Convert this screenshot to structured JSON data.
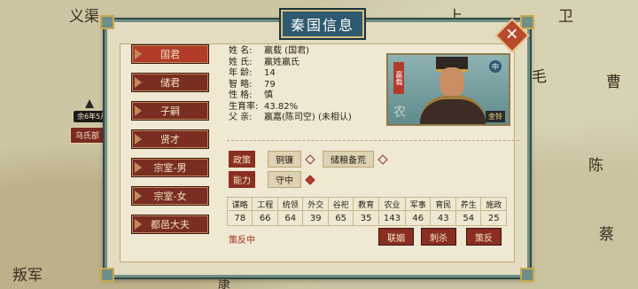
{
  "map": {
    "labels": [
      "义渠",
      "上",
      "卫",
      "毛",
      "曹",
      "陈",
      "蔡",
      "叛军",
      "康"
    ],
    "marker_text": "余6年5月",
    "city_name": "乌氏部"
  },
  "dialog": {
    "title": "秦国信息",
    "close_label": "✕"
  },
  "nav": [
    {
      "label": "国君",
      "active": true
    },
    {
      "label": "储君"
    },
    {
      "label": "子嗣"
    },
    {
      "label": "贤才"
    },
    {
      "label": "宗室-男"
    },
    {
      "label": "宗室-女"
    },
    {
      "label": "都邑大夫"
    }
  ],
  "ruler": {
    "name_label": "姓  名:",
    "name": "嬴载 (国君)",
    "clan_label": "姓  氏:",
    "clan": "嬴姓嬴氏",
    "age_label": "年  龄:",
    "age": "14",
    "int_label": "智  略:",
    "int": "79",
    "trait_label": "性  格:",
    "trait": "慎",
    "fert_label": "生育率:",
    "fert": "43.82%",
    "father_label": "父  亲:",
    "father": "嬴嘉(陈司空) (未相认)"
  },
  "portrait": {
    "vertical_tag": "嬴载",
    "rank_tag": "中",
    "culture_tag": "农",
    "gold_tag": "金铃"
  },
  "policies": {
    "policy_label": "政策",
    "policy_1": "铜镰",
    "policy_2": "储粮备荒",
    "ability_label": "能力",
    "ability_1": "守中"
  },
  "stats": {
    "headers": [
      "谋略",
      "工程",
      "统领",
      "外交",
      "谷祀",
      "教育",
      "农业",
      "军事",
      "育民",
      "养生",
      "施政"
    ],
    "values": [
      "78",
      "66",
      "64",
      "39",
      "65",
      "35",
      "143",
      "46",
      "43",
      "54",
      "25"
    ]
  },
  "status": {
    "rebel_text": "策反中"
  },
  "actions": {
    "ally": "联姻",
    "assassinate": "刺杀",
    "incite": "策反"
  },
  "colors": {
    "accent_red": "#8a2e22",
    "frame_teal": "#6f8f86",
    "title_blue": "#2e5a6f"
  }
}
